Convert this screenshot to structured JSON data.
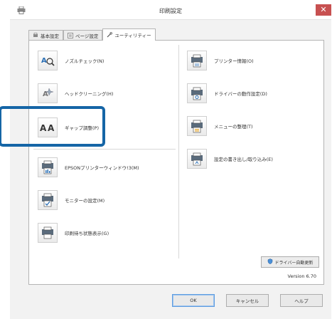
{
  "window": {
    "title": "印刷設定",
    "close_label": "✕"
  },
  "tabs": [
    {
      "label": "基本設定",
      "icon": "printer-page-icon"
    },
    {
      "label": "ページ設定",
      "icon": "page-layout-icon"
    },
    {
      "label": "ユーティリティー",
      "icon": "wrench-icon"
    }
  ],
  "utilities_left": [
    {
      "label": "ノズルチェック(N)",
      "icon": "nozzle-check-icon"
    },
    {
      "label": "ヘッドクリーニング(H)",
      "icon": "head-cleaning-icon"
    },
    {
      "label": "ギャップ調整(P)",
      "icon": "gap-adjust-icon"
    },
    {
      "label": "EPSONプリンターウィンドウ!3(M)",
      "icon": "printer-window-icon"
    },
    {
      "label": "モニターの設定(M)",
      "icon": "monitor-settings-icon"
    },
    {
      "label": "印刷待ち状態表示(G)",
      "icon": "print-queue-icon"
    }
  ],
  "utilities_right": [
    {
      "label": "プリンター情報(O)",
      "icon": "printer-info-icon"
    },
    {
      "label": "ドライバーの動作設定(D)",
      "icon": "driver-settings-icon"
    },
    {
      "label": "メニューの整理(T)",
      "icon": "menu-arrange-icon"
    },
    {
      "label": "設定の書き出し/取り込み(E)",
      "icon": "export-import-icon"
    }
  ],
  "auto_update_label": "ドライバー自動更新",
  "version_text": "Version 6.70",
  "buttons": {
    "ok": "OK",
    "cancel": "キャンセル",
    "help": "ヘルプ"
  },
  "colors": {
    "highlight": "#1565a6",
    "close": "#c75050"
  }
}
